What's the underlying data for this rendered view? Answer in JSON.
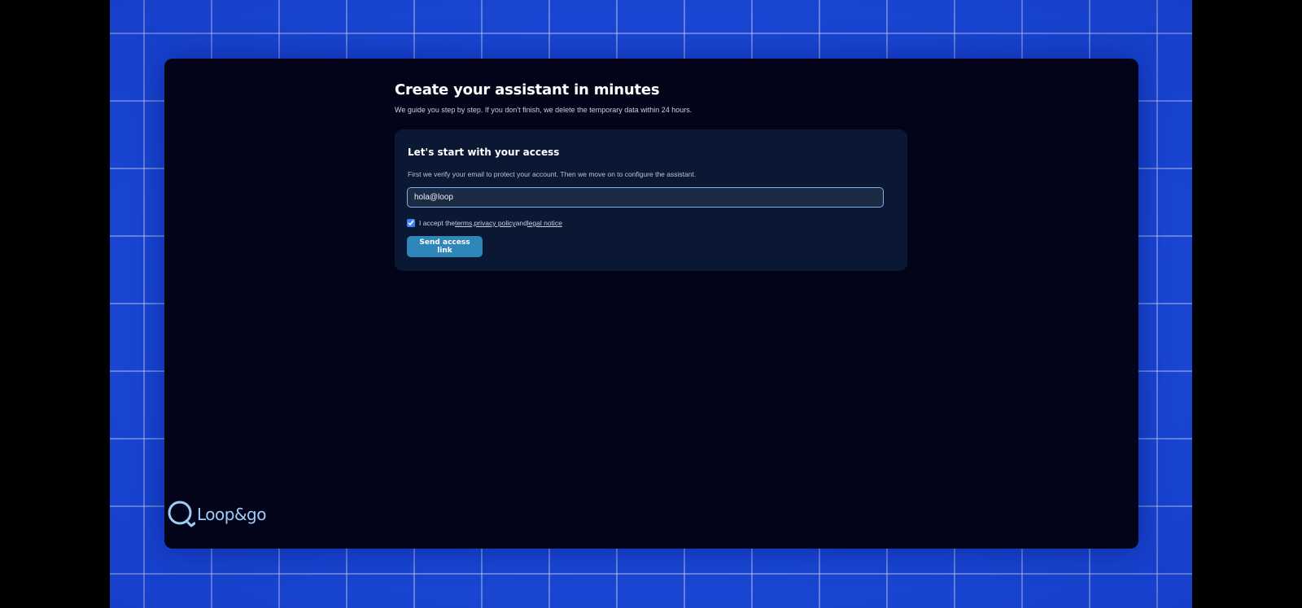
{
  "page": {
    "title": "Create your assistant in minutes",
    "subtitle": "We guide you step by step. If you don't finish, we delete the temporary data within 24 hours."
  },
  "access_card": {
    "title": "Let's start with your access",
    "description": "First we verify your email to protect your account. Then we move on to configure the assistant.",
    "email_value": "hola@loop",
    "consent": {
      "checked": true,
      "prefix": "I accept the ",
      "terms_label": "terms",
      "separator": ", ",
      "privacy_label": "privacy policy",
      "conjunction": " and ",
      "legal_label": "legal notice"
    },
    "send_button_label": "Send access link"
  },
  "brand": {
    "name": "Loop&go",
    "logo_icon": "loop-icon"
  },
  "colors": {
    "stage_background": "#1b4bd8",
    "window_background": "#03041a",
    "card_background": "#0b1833",
    "input_border": "#7fb0ee",
    "button": "#2f86b9",
    "brand_text": "#9ecdf4"
  }
}
